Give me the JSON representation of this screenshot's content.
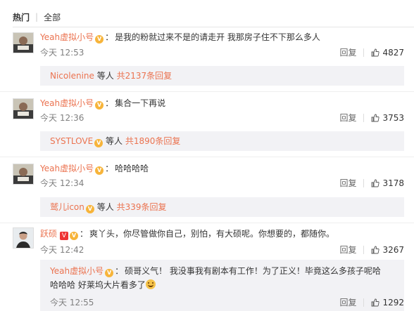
{
  "tabs": {
    "hot": "热门",
    "all": "全部"
  },
  "colors": {
    "username": "#eb7350",
    "reply_bg": "#f2f2f5",
    "muted": "#808080"
  },
  "labels": {
    "reply": "回复",
    "sep": "：",
    "and_others": "等人"
  },
  "comments": [
    {
      "user": "Yeah虚拟小号",
      "text": "是我的粉就过来不是的请走开 我那房子住不下那么多人",
      "time": "今天 12:53",
      "likes": "4827",
      "reply_user": "Nicolenine",
      "reply_count": "共2137条回复"
    },
    {
      "user": "Yeah虚拟小号",
      "text": "集合一下再说",
      "time": "今天 12:36",
      "likes": "3753",
      "reply_user": "SYSTLOVE",
      "reply_count": "共1890条回复"
    },
    {
      "user": "Yeah虚拟小号",
      "text": "哈哈哈哈",
      "time": "今天 12:34",
      "likes": "3178",
      "reply_user": "鹫儿icon",
      "reply_count": "共339条回复"
    },
    {
      "user": "跃硕",
      "text": "爽丫头，你尽管做你自己，别怕，有大硕呢。你想要的，都随你。",
      "time": "今天 12:42",
      "likes": "3267"
    }
  ],
  "sub_reply": {
    "user": "Yeah虚拟小号",
    "text": "硕哥义气！ 我没事我有剧本有工作！为了正义！毕竟这么多孩子呢哈哈哈哈 好莱坞大片看多了",
    "time": "今天 12:55",
    "likes": "1292"
  }
}
